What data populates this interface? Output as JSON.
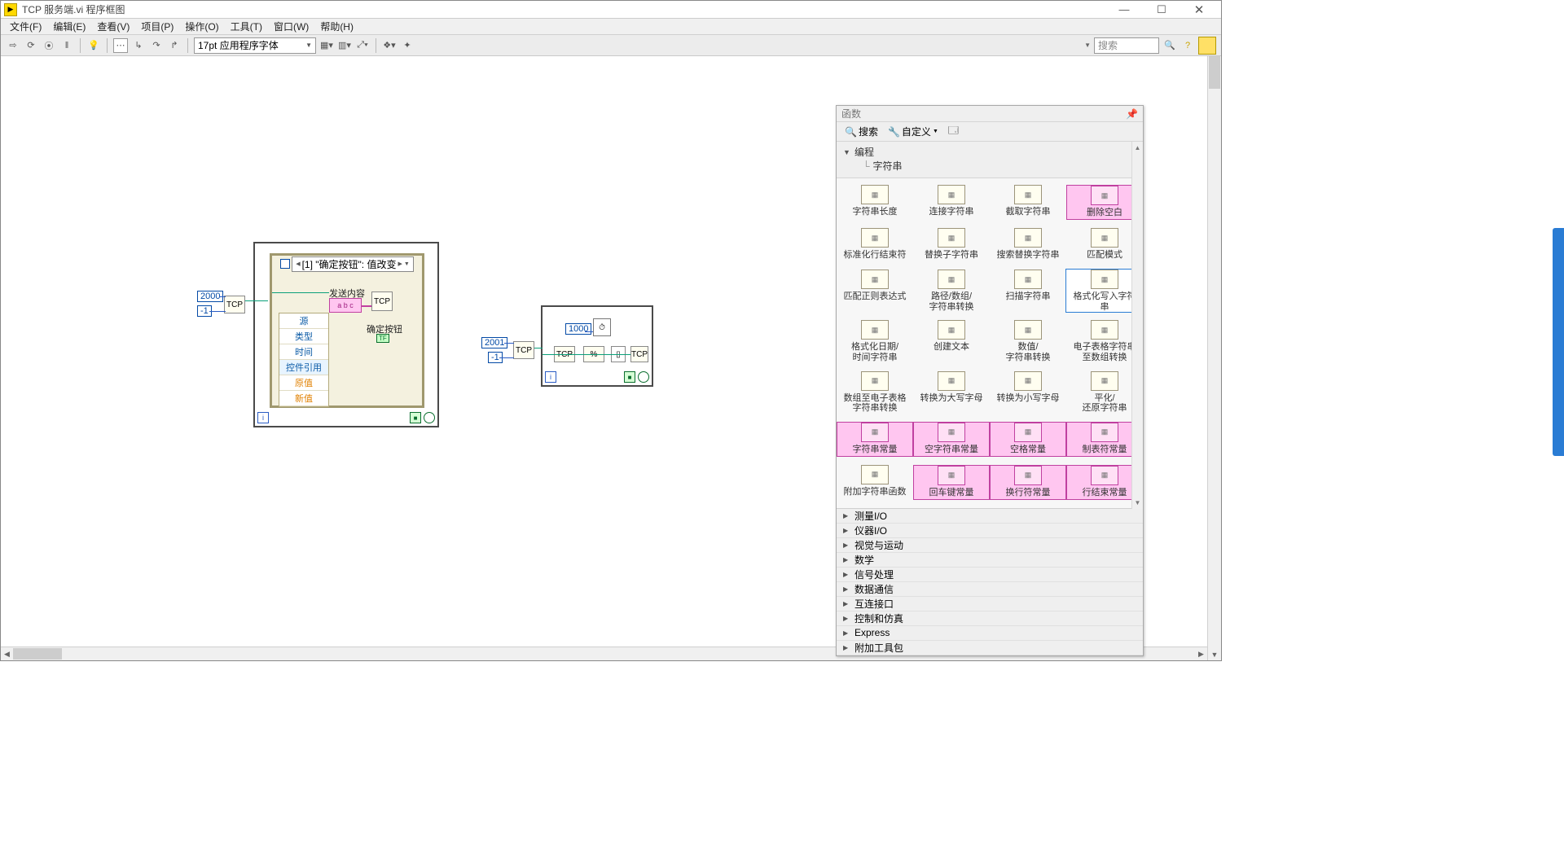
{
  "window": {
    "title": "TCP 服务端.vi 程序框图"
  },
  "menu": [
    "文件(F)",
    "编辑(E)",
    "查看(V)",
    "项目(P)",
    "操作(O)",
    "工具(T)",
    "窗口(W)",
    "帮助(H)"
  ],
  "toolbar": {
    "font": "17pt 应用程序字体",
    "searchPlaceholder": "搜索"
  },
  "diagram": {
    "const2000": "2000",
    "constNeg1a": "-1",
    "const2001": "2001",
    "constNeg1b": "-1",
    "const1000": "1000",
    "evHeader": "[1] \"确定按钮\": 值改变",
    "evList": [
      "源",
      "类型",
      "时间",
      "控件引用",
      "原值",
      "新值"
    ],
    "sendLabel": "发送内容",
    "sendVal": "a b c",
    "okBtnLabel": "确定按钮",
    "tf": "TF"
  },
  "palette": {
    "title": "函数",
    "searchLabel": "搜索",
    "customLabel": "自定义",
    "tree": {
      "root": "编程",
      "sub": "字符串"
    },
    "items": [
      {
        "l": "字符串长度"
      },
      {
        "l": "连接字符串"
      },
      {
        "l": "截取字符串"
      },
      {
        "l": "删除空白",
        "pink": true
      },
      {
        "l": "标准化行结束符"
      },
      {
        "l": "替换子字符串"
      },
      {
        "l": "搜索替换字符串"
      },
      {
        "l": "匹配模式"
      },
      {
        "l": "匹配正则表达式"
      },
      {
        "l": "路径/数组/\n字符串转换"
      },
      {
        "l": "扫描字符串"
      },
      {
        "l": "格式化写入字符\n串",
        "sel": true
      },
      {
        "l": "格式化日期/\n时间字符串"
      },
      {
        "l": "创建文本"
      },
      {
        "l": "数值/\n字符串转换"
      },
      {
        "l": "电子表格字符串\n至数组转换"
      },
      {
        "l": "数组至电子表格\n字符串转换"
      },
      {
        "l": "转换为大写字母"
      },
      {
        "l": "转换为小写字母"
      },
      {
        "l": "平化/\n还原字符串"
      },
      {
        "l": "字符串常量",
        "pink": true
      },
      {
        "l": "空字符串常量",
        "pink": true
      },
      {
        "l": "空格常量",
        "pink": true
      },
      {
        "l": "制表符常量",
        "pink": true
      },
      {
        "l": "附加字符串函数"
      },
      {
        "l": "回车键常量",
        "pink": true
      },
      {
        "l": "换行符常量",
        "pink": true
      },
      {
        "l": "行结束常量",
        "pink": true
      }
    ],
    "cats": [
      "测量I/O",
      "仪器I/O",
      "视觉与运动",
      "数学",
      "信号处理",
      "数据通信",
      "互连接口",
      "控制和仿真",
      "Express",
      "附加工具包"
    ]
  }
}
